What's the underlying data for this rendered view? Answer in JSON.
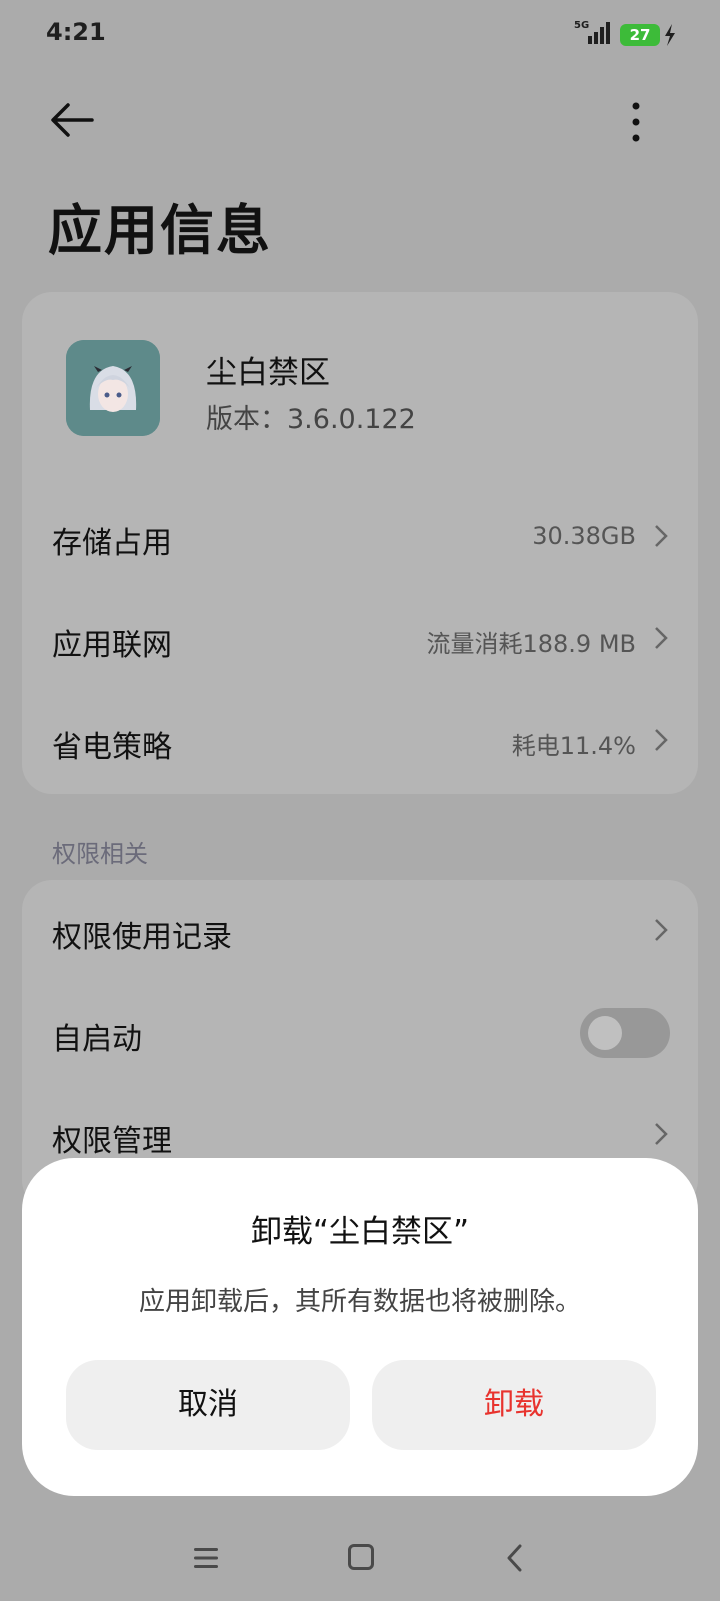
{
  "status_bar": {
    "time": "4:21",
    "network": "5G",
    "battery": "27"
  },
  "page": {
    "title": "应用信息"
  },
  "app": {
    "name": "尘白禁区",
    "version": "版本：3.6.0.122"
  },
  "info_rows": [
    {
      "label": "存储占用",
      "value": "30.38GB"
    },
    {
      "label": "应用联网",
      "value": "流量消耗188.9 MB"
    },
    {
      "label": "省电策略",
      "value": "耗电11.4%"
    }
  ],
  "permissions": {
    "section_title": "权限相关",
    "rows": [
      {
        "label": "权限使用记录"
      },
      {
        "label": "自启动",
        "toggle_on": false
      },
      {
        "label": "权限管理"
      }
    ]
  },
  "dialog": {
    "title": "卸载“尘白禁区”",
    "message": "应用卸载后，其所有数据也将被删除。",
    "cancel_label": "取消",
    "confirm_label": "卸载"
  },
  "colors": {
    "scrim": "#ababab",
    "danger": "#e8332e",
    "battery": "#3dbb39"
  }
}
